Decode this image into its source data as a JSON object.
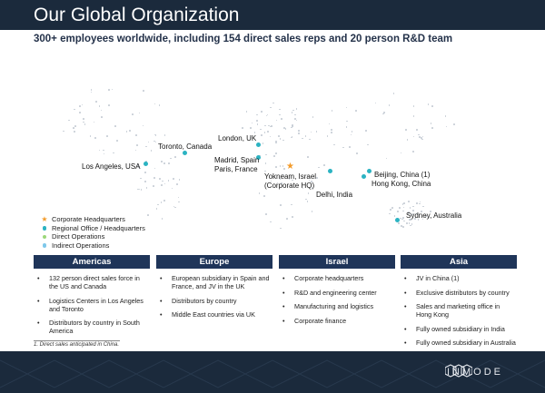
{
  "header": {
    "title": "Our Global Organization",
    "subtitle": "300+ employees worldwide, including 154 direct sales reps and 20 person R&D team"
  },
  "map": {
    "cities": {
      "los_angeles": "Los Angeles, USA",
      "toronto": "Toronto, Canada",
      "london": "London, UK",
      "madrid": "Madrid, Spain\nParis, France",
      "yokneam": "Yokneam, Israel\n(Corporate HQ)",
      "delhi": "Delhi, India",
      "beijing": "Beijing, China (1)",
      "hong_kong": "Hong Kong, China",
      "sydney": "Sydney, Australia"
    }
  },
  "legend": {
    "items": [
      {
        "label": "Corporate Headquarters",
        "marker": "star",
        "color": "#f39b2a"
      },
      {
        "label": "Regional Office / Headquarters",
        "marker": "dot",
        "color": "#2bb3c2"
      },
      {
        "label": "Direct Operations",
        "marker": "dot",
        "color": "#9bd77a"
      },
      {
        "label": "Indirect Operations",
        "marker": "dot",
        "color": "#7fc8ea"
      }
    ]
  },
  "regions": [
    {
      "title": "Americas",
      "bullets": [
        "132 person direct sales force in the US and Canada",
        "Logistics Centers in Los Angeles and Toronto",
        "Distributors by country in South America"
      ]
    },
    {
      "title": "Europe",
      "bullets": [
        "European subsidiary in Spain and France, and JV in the UK",
        "Distributors by country",
        "Middle East countries via UK"
      ]
    },
    {
      "title": "Israel",
      "bullets": [
        "Corporate headquarters",
        "R&D and engineering center",
        "Manufacturing and logistics",
        "Corporate finance"
      ]
    },
    {
      "title": "Asia",
      "bullets": [
        "JV in China (1)",
        "Exclusive distributors by country",
        "Sales and marketing office in Hong Kong",
        "Fully owned subsidiary in India",
        "Fully owned subsidiary in Australia"
      ]
    }
  ],
  "footnote": "1. Direct sales anticipated in China.",
  "footer": {
    "brand": "INMODE"
  },
  "colors": {
    "navy": "#1b2a3c",
    "region_header": "#1f3559",
    "teal_dot": "#2bb3c2",
    "hq_orange": "#f39b2a"
  }
}
